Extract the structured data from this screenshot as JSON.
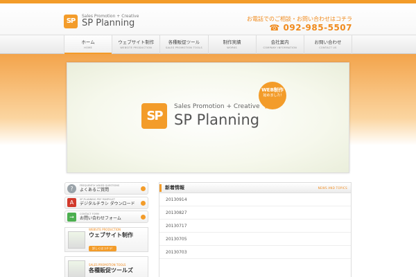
{
  "brand": {
    "mark": "SP",
    "tagline": "Sales Promotion + Creative",
    "name": "SP Planning"
  },
  "contact": {
    "text": "お電話でのご相談・お問い合わせはコチラ",
    "phone": "☎ 092-985-5507"
  },
  "nav": [
    {
      "jp": "ホーム",
      "en": "HOME"
    },
    {
      "jp": "ウェブサイト制作",
      "en": "WEBSITE PRODUCTION"
    },
    {
      "jp": "各種販促ツール",
      "en": "SALES PROMOTION TOOLS"
    },
    {
      "jp": "制作実績",
      "en": "WORKS"
    },
    {
      "jp": "会社案内",
      "en": "COMPANY INFORMATION"
    },
    {
      "jp": "お問い合わせ",
      "en": "CONTACT US"
    }
  ],
  "hero": {
    "mark": "SP",
    "tagline": "Sales Promotion + Creative",
    "name": "SP Planning",
    "bubble_line1": "WEB制作",
    "bubble_line2": "始めました!"
  },
  "sidebar": {
    "links": [
      {
        "en": "FREQUENTLY ASKED QUESTIONS",
        "jp": "よくあるご質問",
        "icon": "?",
        "color": "#9aa3a9"
      },
      {
        "en": "SP PLANNING PDF PAMPHLET",
        "jp": "デジタルチラシ ダウンロード",
        "icon": "A",
        "color": "#d23a2c"
      },
      {
        "en": "CONTACT FORM",
        "jp": "お問い合わせフォーム",
        "icon": "→",
        "color": "#4caf50"
      }
    ],
    "banners": [
      {
        "en": "WEBSITE PRODUCTION",
        "jp": "ウェブサイト制作",
        "btn": "詳しくはコチラ!"
      },
      {
        "en": "SALES PROMOTION TOOLS",
        "jp": "各種販促ツールズ",
        "btn": ""
      }
    ]
  },
  "news": {
    "title": "新着情報",
    "en": "NEWS AND TOPICS",
    "items": [
      "20130914",
      "20130827",
      "20130717",
      "20130705",
      "20130703"
    ]
  },
  "colors": {
    "accent": "#f39c2a",
    "accent_text": "#f08a1c"
  }
}
